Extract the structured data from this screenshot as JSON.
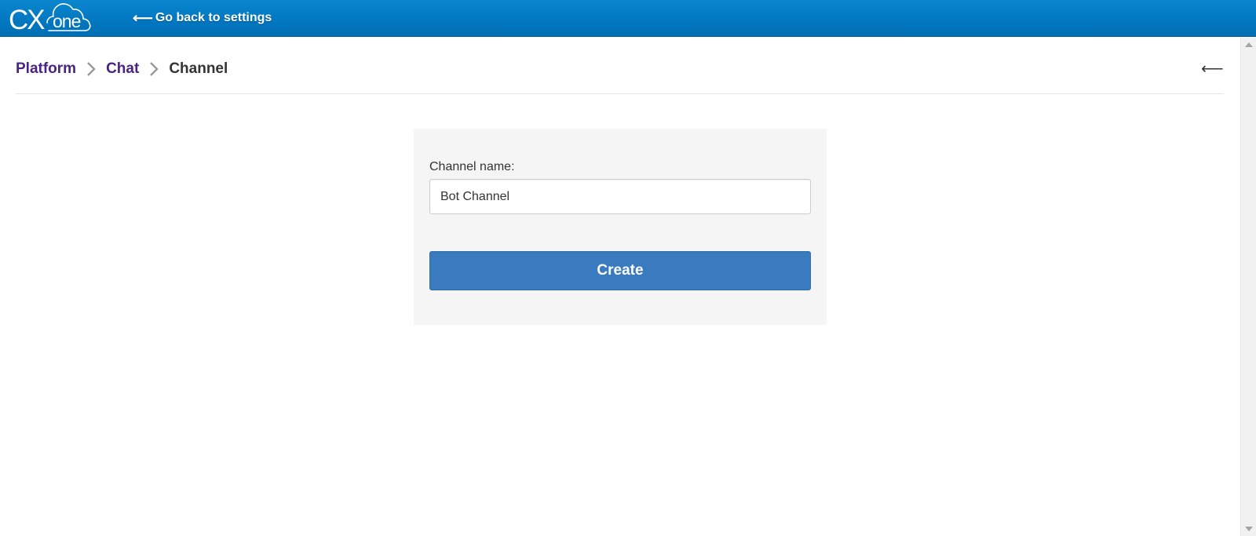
{
  "header": {
    "logo": {
      "main": "CX",
      "sub": "one",
      "icon": "cloud-icon"
    },
    "back_link": {
      "arrow": "⟵",
      "label": "Go back to settings"
    }
  },
  "breadcrumb": {
    "items": [
      {
        "label": "Platform"
      },
      {
        "label": "Chat"
      },
      {
        "label": "Channel"
      }
    ],
    "separator_icon": "chevron-right-icon"
  },
  "page_back": {
    "icon": "arrow-left-icon",
    "glyph": "⟵"
  },
  "form": {
    "channel_name_label": "Channel name:",
    "channel_name_value": "Bot Channel",
    "create_label": "Create"
  },
  "colors": {
    "header_blue": "#0177c0",
    "breadcrumb_link": "#4a2382",
    "button_blue": "#3a7bbf",
    "panel_bg": "#f5f5f5"
  }
}
